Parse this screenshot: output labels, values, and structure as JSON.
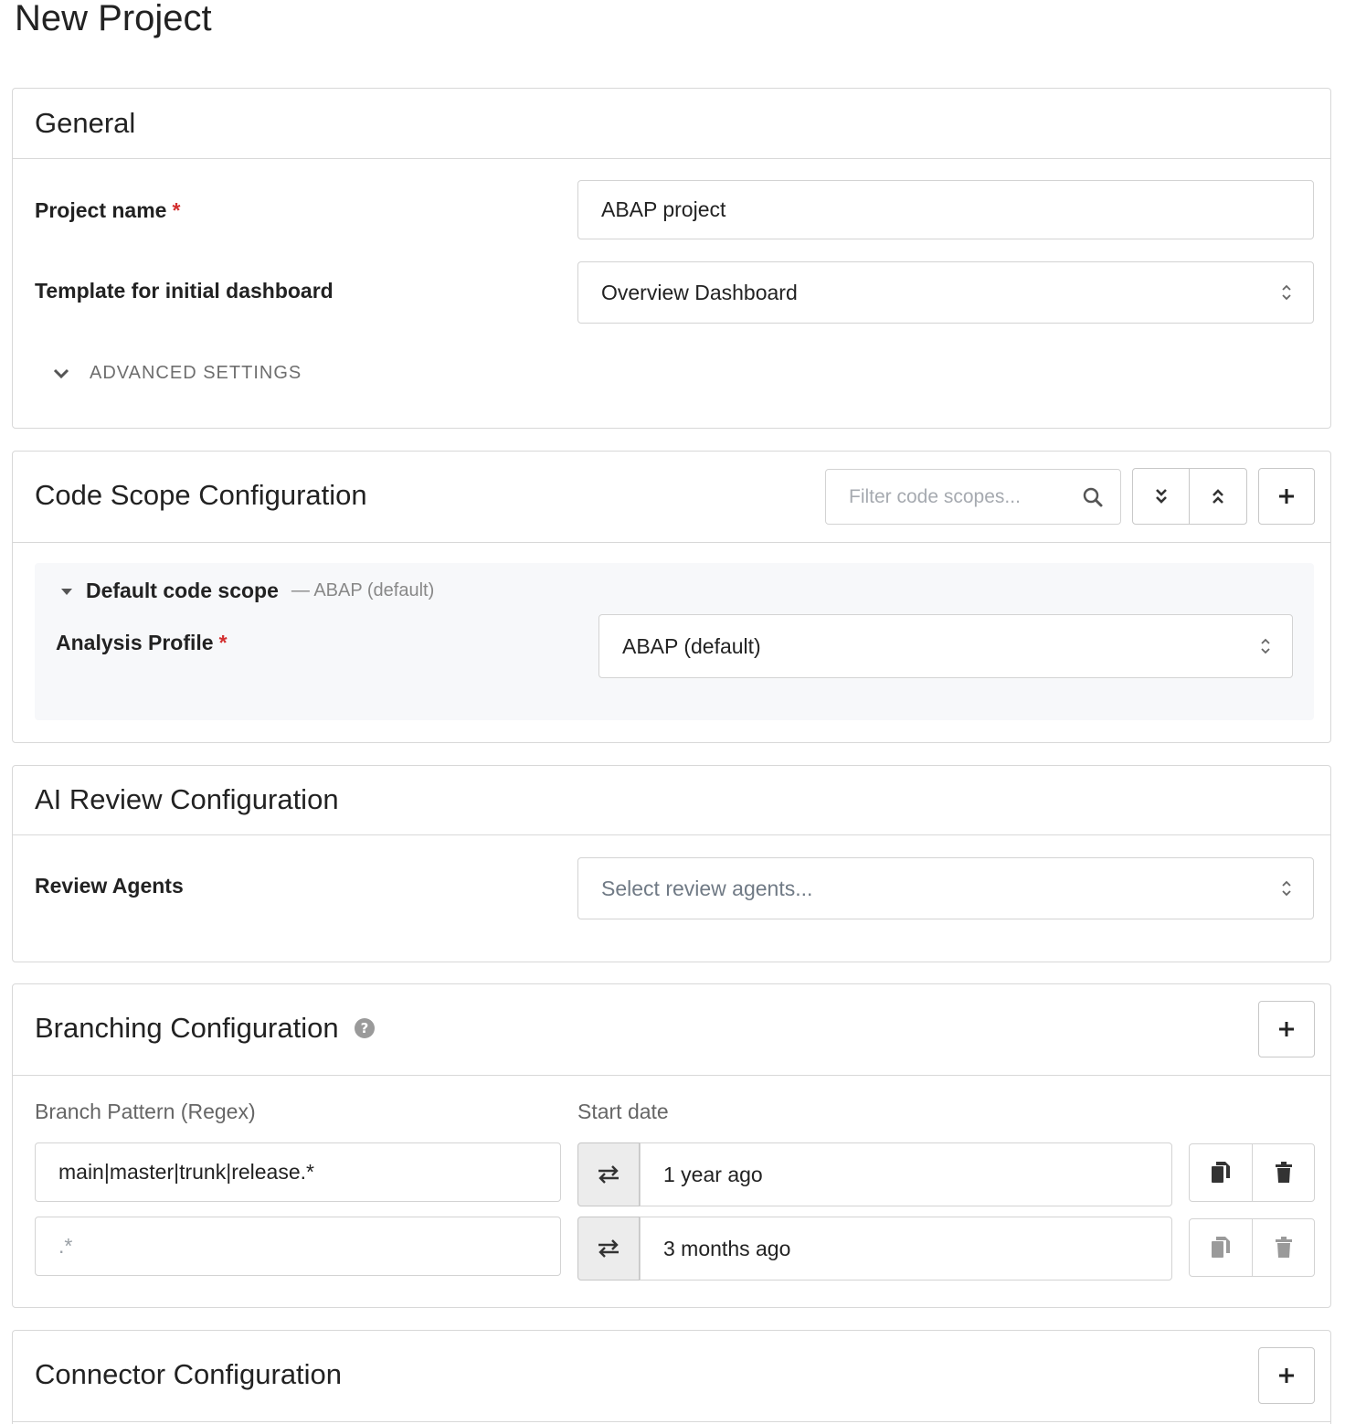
{
  "page": {
    "title": "New Project"
  },
  "general": {
    "title": "General",
    "project_name_label": "Project name",
    "required_mark": "*",
    "project_name_value": "ABAP project",
    "template_label": "Template for initial dashboard",
    "template_value": "Overview Dashboard",
    "advanced_label": "ADVANCED SETTINGS"
  },
  "code_scope": {
    "title": "Code Scope Configuration",
    "filter_placeholder": "Filter code scopes...",
    "scope_name": "Default code scope",
    "scope_meta": "— ABAP (default)",
    "profile_label": "Analysis Profile",
    "profile_value": "ABAP (default)"
  },
  "ai_review": {
    "title": "AI Review Configuration",
    "agents_label": "Review Agents",
    "agents_placeholder": "Select review agents..."
  },
  "branching": {
    "title": "Branching Configuration",
    "pattern_header": "Branch Pattern (Regex)",
    "start_header": "Start date",
    "rows": [
      {
        "pattern": "main|master|trunk|release.*",
        "start": "1 year ago",
        "actions_enabled": true
      },
      {
        "pattern": ".*",
        "start": "3 months ago",
        "actions_enabled": false
      }
    ]
  },
  "connector": {
    "title": "Connector Configuration"
  }
}
